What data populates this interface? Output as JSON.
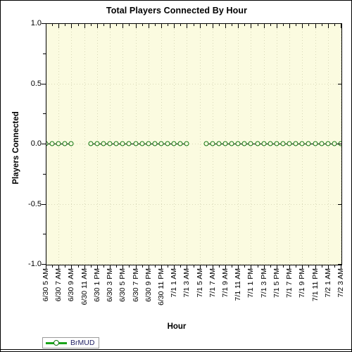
{
  "chart_data": {
    "type": "line",
    "title": "Total Players Connected By Hour",
    "xlabel": "Hour",
    "ylabel": "Players Connected",
    "ylim": [
      -1.0,
      1.0
    ],
    "yticks": [
      "1.0",
      "0.5",
      "0.0",
      "-0.5",
      "-1.0"
    ],
    "ytick_values": [
      1.0,
      0.5,
      0.0,
      -0.5,
      -1.0
    ],
    "grid": true,
    "grid_style": "dotted",
    "legend_position": "bottom-left",
    "categories": [
      "6/30 5 AM",
      "6/30 6 AM",
      "6/30 7 AM",
      "6/30 8 AM",
      "6/30 9 AM",
      "6/30 10 AM",
      "6/30 11 AM",
      "6/30 12 PM",
      "6/30 1 PM",
      "6/30 2 PM",
      "6/30 3 PM",
      "6/30 4 PM",
      "6/30 5 PM",
      "6/30 6 PM",
      "6/30 7 PM",
      "6/30 8 PM",
      "6/30 9 PM",
      "6/30 10 PM",
      "6/30 11 PM",
      "7/1 12 AM",
      "7/1 1 AM",
      "7/1 2 AM",
      "7/1 3 AM",
      "7/1 4 AM",
      "7/1 5 AM",
      "7/1 6 AM",
      "7/1 7 AM",
      "7/1 8 AM",
      "7/1 9 AM",
      "7/1 10 AM",
      "7/1 11 AM",
      "7/1 12 PM",
      "7/1 1 PM",
      "7/1 2 PM",
      "7/1 3 PM",
      "7/1 4 PM",
      "7/1 5 PM",
      "7/1 6 PM",
      "7/1 7 PM",
      "7/1 8 PM",
      "7/1 9 PM",
      "7/1 10 PM",
      "7/1 11 PM",
      "7/2 12 AM",
      "7/2 1 AM",
      "7/2 2 AM",
      "7/2 3 AM"
    ],
    "tick_labels": [
      "6/30 5 AM",
      "6/30 7 AM",
      "6/30 9 AM",
      "6/30 11 AM",
      "6/30 1 PM",
      "6/30 3 PM",
      "6/30 5 PM",
      "6/30 7 PM",
      "6/30 9 PM",
      "6/30 11 PM",
      "7/1 1 AM",
      "7/1 3 AM",
      "7/1 5 AM",
      "7/1 7 AM",
      "7/1 9 AM",
      "7/1 11 AM",
      "7/1 1 PM",
      "7/1 3 PM",
      "7/1 5 PM",
      "7/1 7 PM",
      "7/1 9 PM",
      "7/1 11 PM",
      "7/2 1 AM",
      "7/2 3 AM"
    ],
    "series": [
      {
        "name": "BrMUD",
        "color": "#117711",
        "line_color": "#1aa51a",
        "values": [
          0,
          0,
          0,
          0,
          0,
          null,
          null,
          0,
          0,
          0,
          0,
          0,
          0,
          0,
          0,
          0,
          0,
          0,
          0,
          0,
          0,
          0,
          0,
          null,
          null,
          0,
          0,
          0,
          0,
          0,
          0,
          0,
          0,
          0,
          0,
          0,
          0,
          0,
          0,
          0,
          0,
          0,
          0,
          0,
          0,
          0,
          0
        ]
      }
    ]
  },
  "legend": {
    "entries": [
      {
        "label": "BrMUD"
      }
    ]
  },
  "colors": {
    "plot_background": "#fbfbe0",
    "page_background": "#ffffff",
    "axis": "#000000",
    "grid": "#d8d8b8",
    "series_marker": "#117711",
    "series_line": "#1aa51a",
    "legend_text": "#222266"
  }
}
